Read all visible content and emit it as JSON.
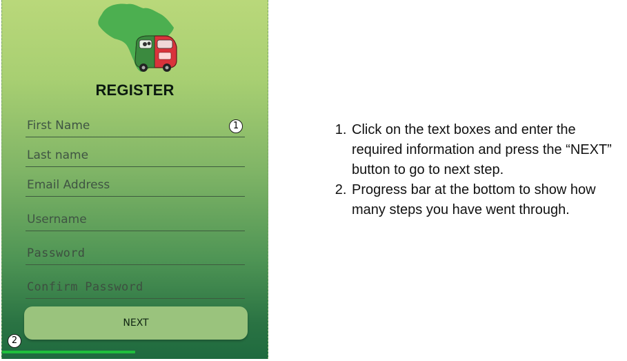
{
  "screen": {
    "title": "REGISTER",
    "fields": {
      "first_name": {
        "placeholder": "First Name"
      },
      "last_name": {
        "placeholder": "Last name"
      },
      "email": {
        "placeholder": "Email Address"
      },
      "username": {
        "placeholder": "Username"
      },
      "password": {
        "placeholder": "Password"
      },
      "confirm_password": {
        "placeholder": "Confirm Password"
      }
    },
    "next_label": "NEXT",
    "progress": {
      "fraction": 0.5
    }
  },
  "callouts": {
    "one": "1",
    "two": "2"
  },
  "instructions": {
    "items": [
      "Click on the text boxes and enter the required information and press the “NEXT” button to go to next step.",
      "Progress bar at the bottom to show how many steps you have went through."
    ]
  },
  "colors": {
    "africa_green": "#4caf50",
    "bus_red": "#d9333b",
    "button": "#9ac37d",
    "progress": "#1fbf3c"
  },
  "icons": {
    "logo": "africa-taxi-logo"
  }
}
